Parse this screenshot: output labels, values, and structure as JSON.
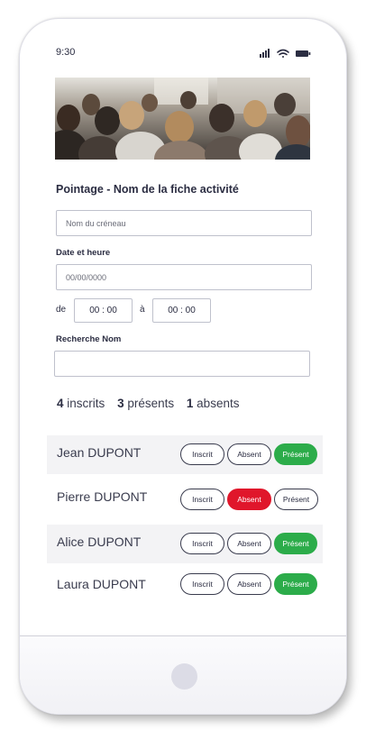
{
  "status": {
    "time": "9:30"
  },
  "page": {
    "title": "Pointage - Nom de la fiche activité"
  },
  "slot": {
    "placeholder": "Nom du créneau"
  },
  "date": {
    "label": "Date et heure",
    "placeholder": "00/00/0000"
  },
  "time": {
    "from_label": "de",
    "from_value": "00 : 00",
    "to_label": "à",
    "to_value": "00 : 00"
  },
  "search": {
    "label": "Recherche Nom",
    "placeholder": ""
  },
  "counts": {
    "inscrits": {
      "value": "4",
      "label": "inscrits"
    },
    "presents": {
      "value": "3",
      "label": "présents"
    },
    "absents": {
      "value": "1",
      "label": "absents"
    }
  },
  "buttons": {
    "inscrit": "Inscrit",
    "absent": "Absent",
    "present": "Présent"
  },
  "attendees": [
    {
      "name": "Jean DUPONT",
      "status": "Présent"
    },
    {
      "name": "Pierre DUPONT",
      "status": "Absent"
    },
    {
      "name": "Alice DUPONT",
      "status": "Présent"
    },
    {
      "name": "Laura DUPONT",
      "status": "Présent"
    }
  ],
  "colors": {
    "present": "#2cac4a",
    "absent": "#e0162b",
    "text": "#2b2d42"
  }
}
